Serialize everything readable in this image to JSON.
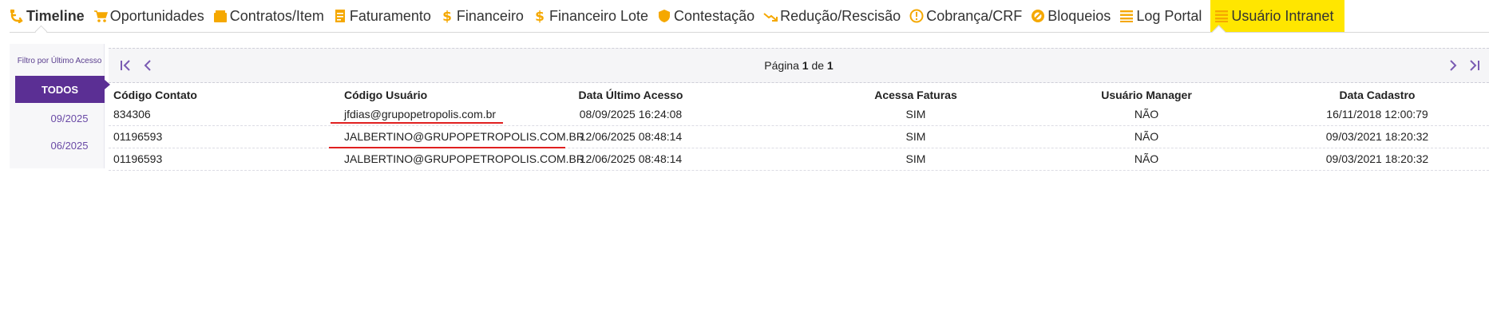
{
  "tabs": [
    {
      "label": "Timeline",
      "icon": "timeline-icon"
    },
    {
      "label": "Oportunidades",
      "icon": "cart-icon"
    },
    {
      "label": "Contratos/Item",
      "icon": "folder-icon"
    },
    {
      "label": "Faturamento",
      "icon": "document-icon"
    },
    {
      "label": "Financeiro",
      "icon": "dollar-icon"
    },
    {
      "label": "Financeiro Lote",
      "icon": "dollar-icon"
    },
    {
      "label": "Contestação",
      "icon": "shield-icon"
    },
    {
      "label": "Redução/Rescisão",
      "icon": "trend-down-icon"
    },
    {
      "label": "Cobrança/CRF",
      "icon": "alert-circle-icon"
    },
    {
      "label": "Bloqueios",
      "icon": "block-icon"
    },
    {
      "label": "Log Portal",
      "icon": "list-icon"
    },
    {
      "label": "Usuário Intranet",
      "icon": "list-icon"
    }
  ],
  "active_tab": "Usuário Intranet",
  "colors": {
    "accent": "#ffe600",
    "icon": "#f5a800",
    "primary": "#5b2f94",
    "link": "#6a4aa6",
    "underline": "#e02020"
  },
  "sidebar": {
    "title": "Filtro por Último Acesso",
    "selected": "TODOS",
    "items": [
      "09/2025",
      "06/2025"
    ]
  },
  "pager": {
    "prefix": "Página",
    "current": "1",
    "sep": "de",
    "total": "1"
  },
  "table": {
    "columns": [
      "Código Contato",
      "Código Usuário",
      "Data Último Acesso",
      "Acessa Faturas",
      "Usuário Manager",
      "Data Cadastro"
    ],
    "rows": [
      [
        "834306",
        "jfdias@grupopetropolis.com.br",
        "08/09/2025 16:24:08",
        "SIM",
        "NÃO",
        "16/11/2018 12:00:79"
      ],
      [
        "01196593",
        "JALBERTINO@GRUPOPETROPOLIS.COM.BR",
        "12/06/2025 08:48:14",
        "SIM",
        "NÃO",
        "09/03/2021 18:20:32"
      ],
      [
        "01196593",
        "JALBERTINO@GRUPOPETROPOLIS.COM.BR",
        "12/06/2025 08:48:14",
        "SIM",
        "NÃO",
        "09/03/2021 18:20:32"
      ]
    ]
  }
}
